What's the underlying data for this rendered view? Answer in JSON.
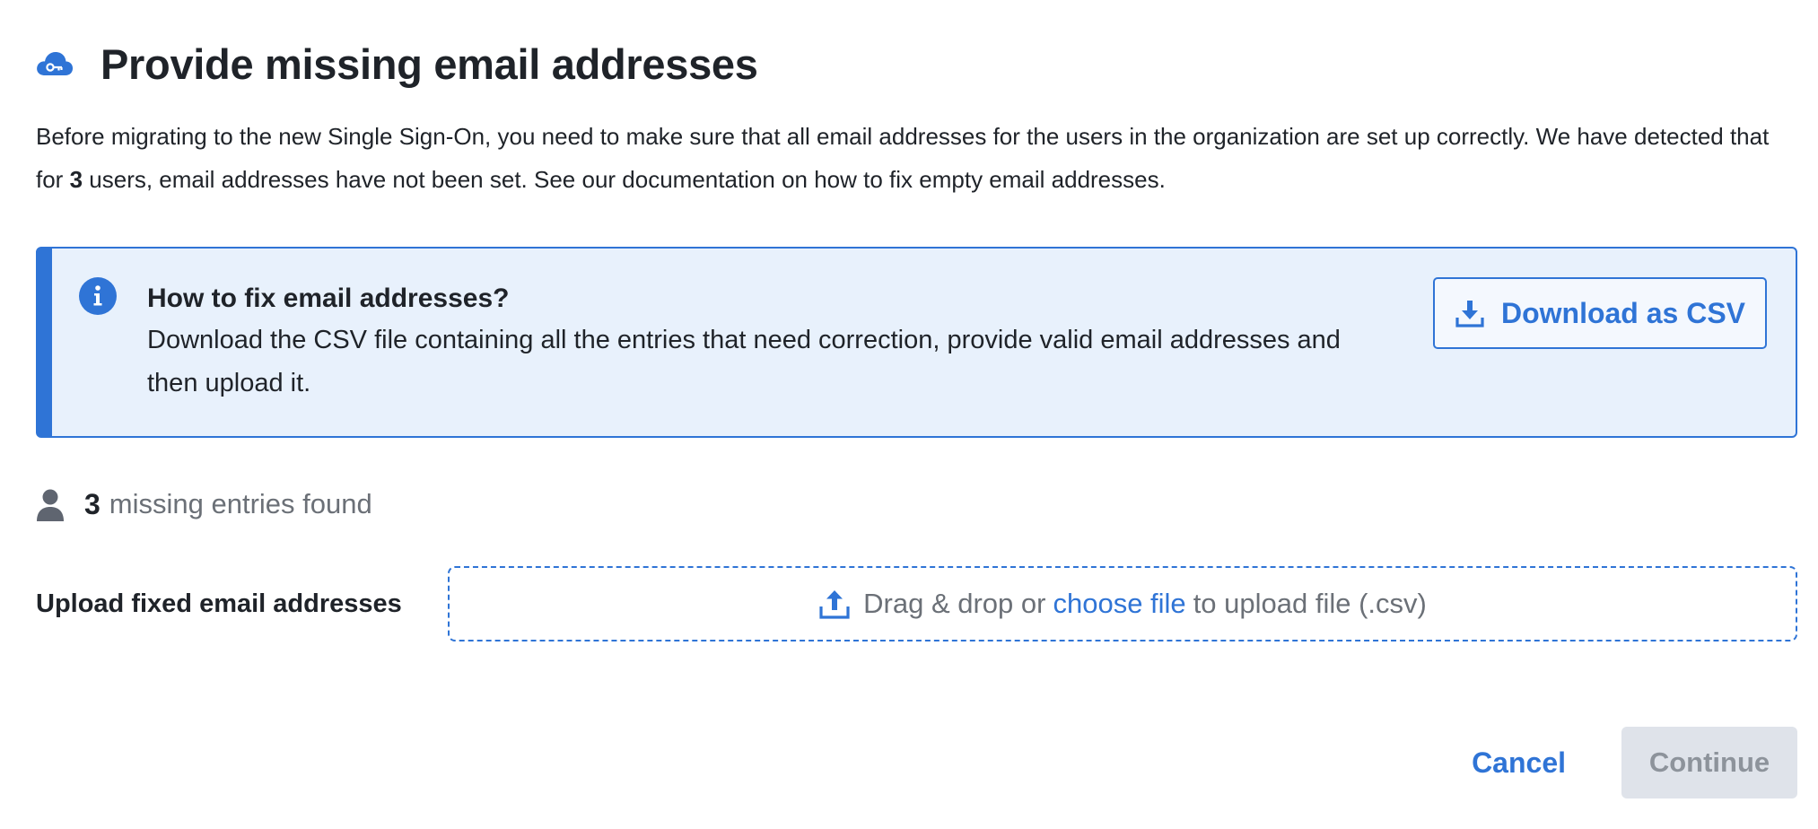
{
  "header": {
    "title": "Provide missing email addresses",
    "icon": "cloud-key-icon"
  },
  "intro": {
    "part1": "Before migrating to the new Single Sign-On, you need to make sure that all email addresses for the users in the organization are set up correctly. We have detected that for ",
    "count": "3",
    "part2": " users, email addresses have not been set. See our documentation on how to fix empty email addresses."
  },
  "callout": {
    "icon": "info-icon",
    "title": "How to fix email addresses?",
    "body": "Download the CSV file containing all the entries that need correction, provide valid email addresses and then upload it.",
    "download_button": {
      "icon": "download-icon",
      "label": "Download as CSV"
    }
  },
  "entries": {
    "icon": "person-icon",
    "count": "3",
    "label": "missing entries found"
  },
  "upload": {
    "label": "Upload fixed email addresses",
    "icon": "upload-icon",
    "text_before": "Drag & drop or",
    "link": "choose file",
    "text_after": "to upload file (.csv)"
  },
  "footer": {
    "cancel_label": "Cancel",
    "continue_label": "Continue"
  },
  "colors": {
    "accent": "#2f74d6",
    "callout_bg": "#e8f1fc",
    "muted_text": "#6b7077",
    "disabled_bg": "#dfe3ea"
  }
}
